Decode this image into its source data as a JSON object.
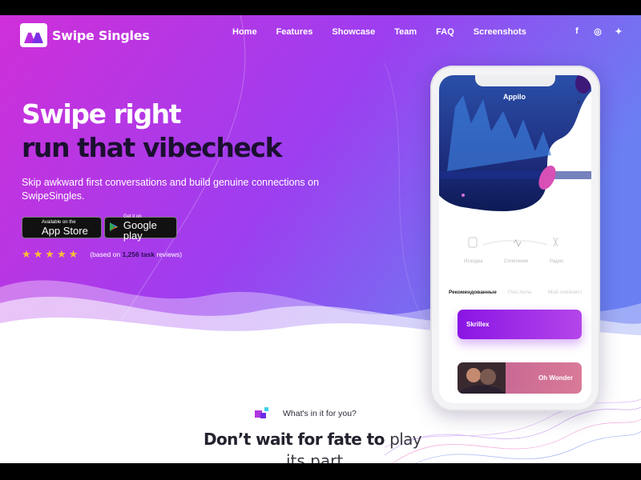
{
  "brand": {
    "name": "Swipe Singles"
  },
  "nav": {
    "items": [
      "Home",
      "Features",
      "Showcase",
      "Team",
      "FAQ",
      "Screenshots"
    ]
  },
  "social": [
    "facebook-icon",
    "instagram-icon",
    "twitter-icon"
  ],
  "hero": {
    "headline_1": "Swipe right",
    "headline_2": "run that vibecheck",
    "subtext": "Skip awkward first conversations and build genuine connections on SwipeSingles.",
    "appstore": {
      "small": "Available on the",
      "big": "App Store"
    },
    "googleplay": {
      "small": "Get it on",
      "big": "Google play"
    },
    "rating": {
      "stars": 5,
      "prefix": "(based on",
      "count": "1,256 task",
      "suffix": "reviews)"
    }
  },
  "phone": {
    "app_title": "Appilo",
    "tabs": [
      "Исходна",
      "Сплетение",
      "Радио"
    ],
    "segments": [
      "Рекомендованные",
      "Поп-Хиты",
      "Мой плейлист"
    ],
    "cards": [
      "Skrillex",
      "Oh Wonder"
    ]
  },
  "section": {
    "eyebrow": "What's in it for you?",
    "title_bold": "Don’t wait for fate to",
    "title_light": "play",
    "title_line2": "its part"
  },
  "colors": {
    "grad_start": "#cf2fd8",
    "grad_mid": "#9d3ef0",
    "grad_end": "#6a7ff2",
    "accent": "#8a15e4"
  }
}
